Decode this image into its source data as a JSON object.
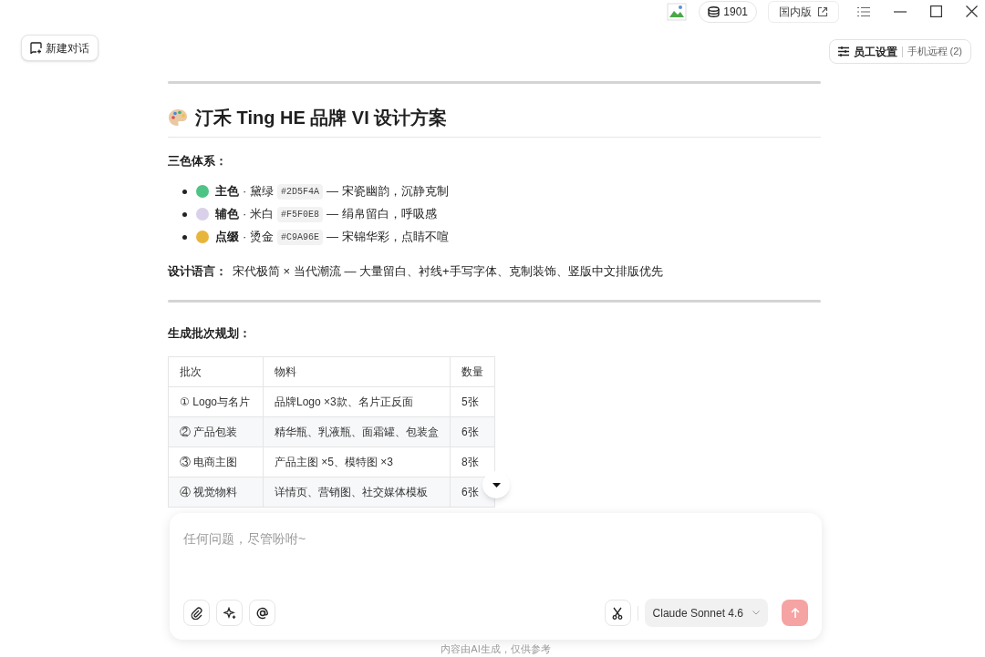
{
  "titlebar": {
    "credits": "1901",
    "edition": "国内版"
  },
  "new_chat": "新建对话",
  "staff": {
    "label": "员工设置",
    "remote": "手机远程 (2)"
  },
  "article": {
    "title": "汀禾 Ting HE 品牌 VI 设计方案",
    "palette_heading": "三色体系：",
    "colors": [
      {
        "role": "主色",
        "name": "· 黛绿",
        "hex": "#2D5F4A",
        "desc": "— 宋瓷幽韵，沉静克制",
        "color": "#4cc486"
      },
      {
        "role": "辅色",
        "name": "· 米白",
        "hex": "#F5F0E8",
        "desc": "— 绢帛留白，呼吸感",
        "color": "#d9d0ea"
      },
      {
        "role": "点缀",
        "name": "· 烫金",
        "hex": "#C9A96E",
        "desc": "— 宋锦华彩，点睛不喧",
        "color": "#e8b53c"
      }
    ],
    "design_language": {
      "label": "设计语言：",
      "text": "宋代极简 × 当代潮流 — 大量留白、衬线+手写字体、克制装饰、竖版中文排版优先"
    },
    "batch_heading": "生成批次规划：",
    "table": {
      "columns": [
        "批次",
        "物料",
        "数量"
      ],
      "rows": [
        [
          "① Logo与名片",
          "品牌Logo ×3款、名片正反面",
          "5张"
        ],
        [
          "② 产品包装",
          "精华瓶、乳液瓶、面霜罐、包装盒",
          "6张"
        ],
        [
          "③ 电商主图",
          "产品主图 ×5、模特图 ×3",
          "8张"
        ],
        [
          "④ 视觉物料",
          "详情页、营销图、社交媒体模板",
          "6张"
        ]
      ]
    }
  },
  "composer": {
    "placeholder": "任何问题，尽管吩咐~",
    "model": "Claude Sonnet 4.6"
  },
  "footer": "内容由AI生成，仅供参考"
}
